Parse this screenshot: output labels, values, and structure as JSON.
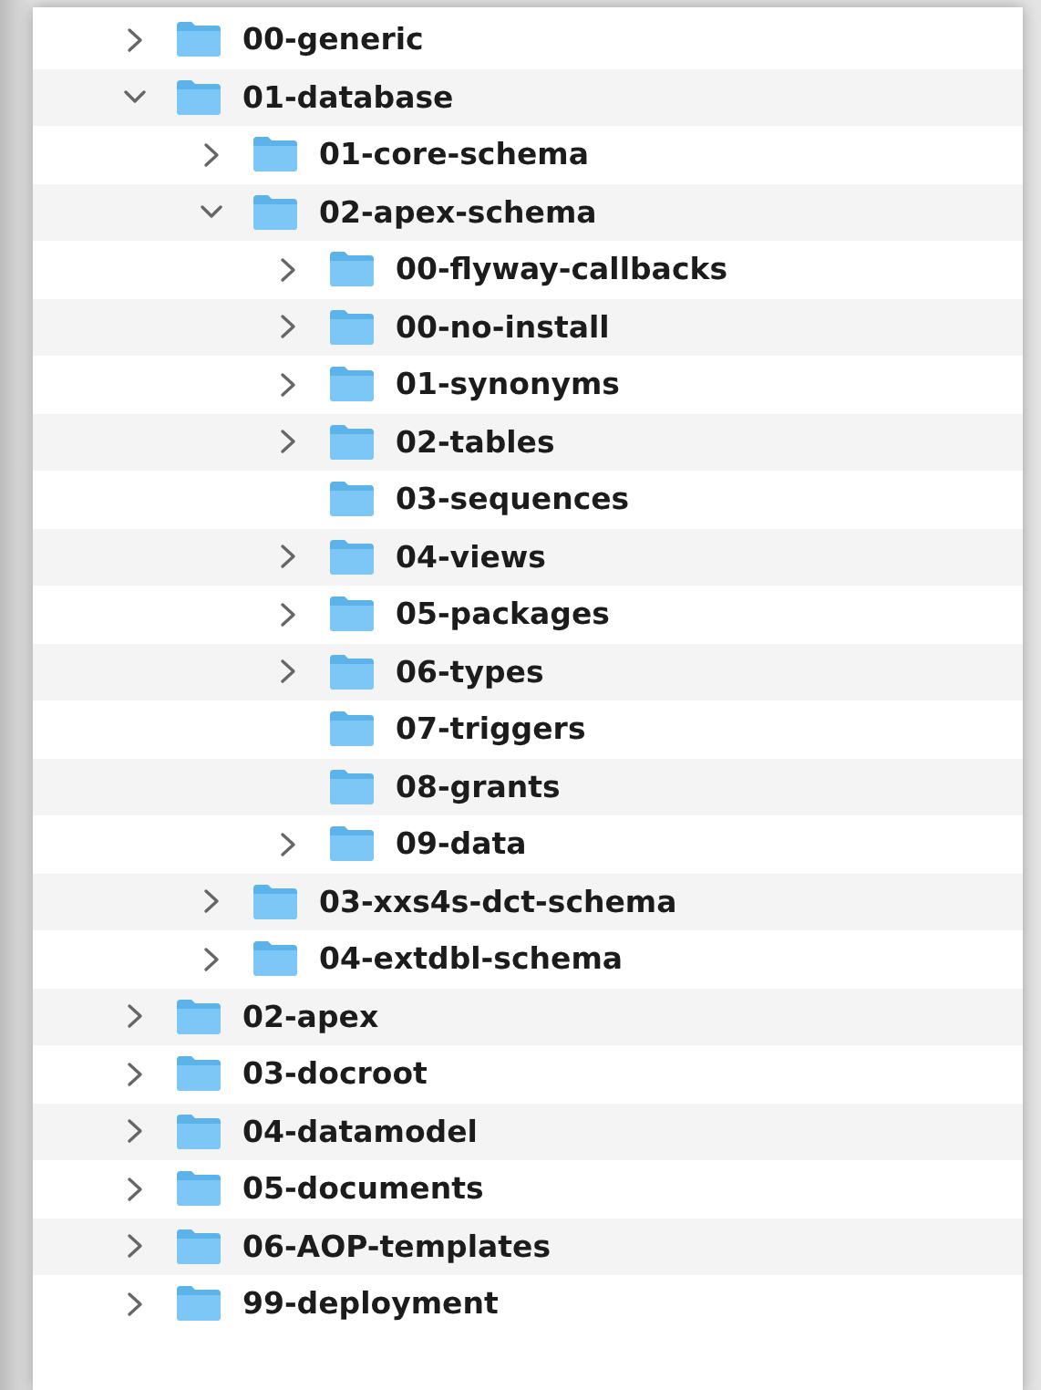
{
  "tree": [
    {
      "name": "00-generic",
      "expanded": false
    },
    {
      "name": "01-database",
      "expanded": true,
      "children": [
        {
          "name": "01-core-schema",
          "expanded": false
        },
        {
          "name": "02-apex-schema",
          "expanded": true,
          "children": [
            {
              "name": "00-flyway-callbacks",
              "expanded": false
            },
            {
              "name": "00-no-install",
              "expanded": false
            },
            {
              "name": "01-synonyms",
              "expanded": false
            },
            {
              "name": "02-tables",
              "expanded": false
            },
            {
              "name": "03-sequences"
            },
            {
              "name": "04-views",
              "expanded": false
            },
            {
              "name": "05-packages",
              "expanded": false
            },
            {
              "name": "06-types",
              "expanded": false
            },
            {
              "name": "07-triggers"
            },
            {
              "name": "08-grants"
            },
            {
              "name": "09-data",
              "expanded": false
            }
          ]
        },
        {
          "name": "03-xxs4s-dct-schema",
          "expanded": false
        },
        {
          "name": "04-extdbl-schema",
          "expanded": false
        }
      ]
    },
    {
      "name": "02-apex",
      "expanded": false
    },
    {
      "name": "03-docroot",
      "expanded": false
    },
    {
      "name": "04-datamodel",
      "expanded": false
    },
    {
      "name": "05-documents",
      "expanded": false
    },
    {
      "name": "06-AOP-templates",
      "expanded": false
    },
    {
      "name": "99-deployment",
      "expanded": false
    }
  ]
}
